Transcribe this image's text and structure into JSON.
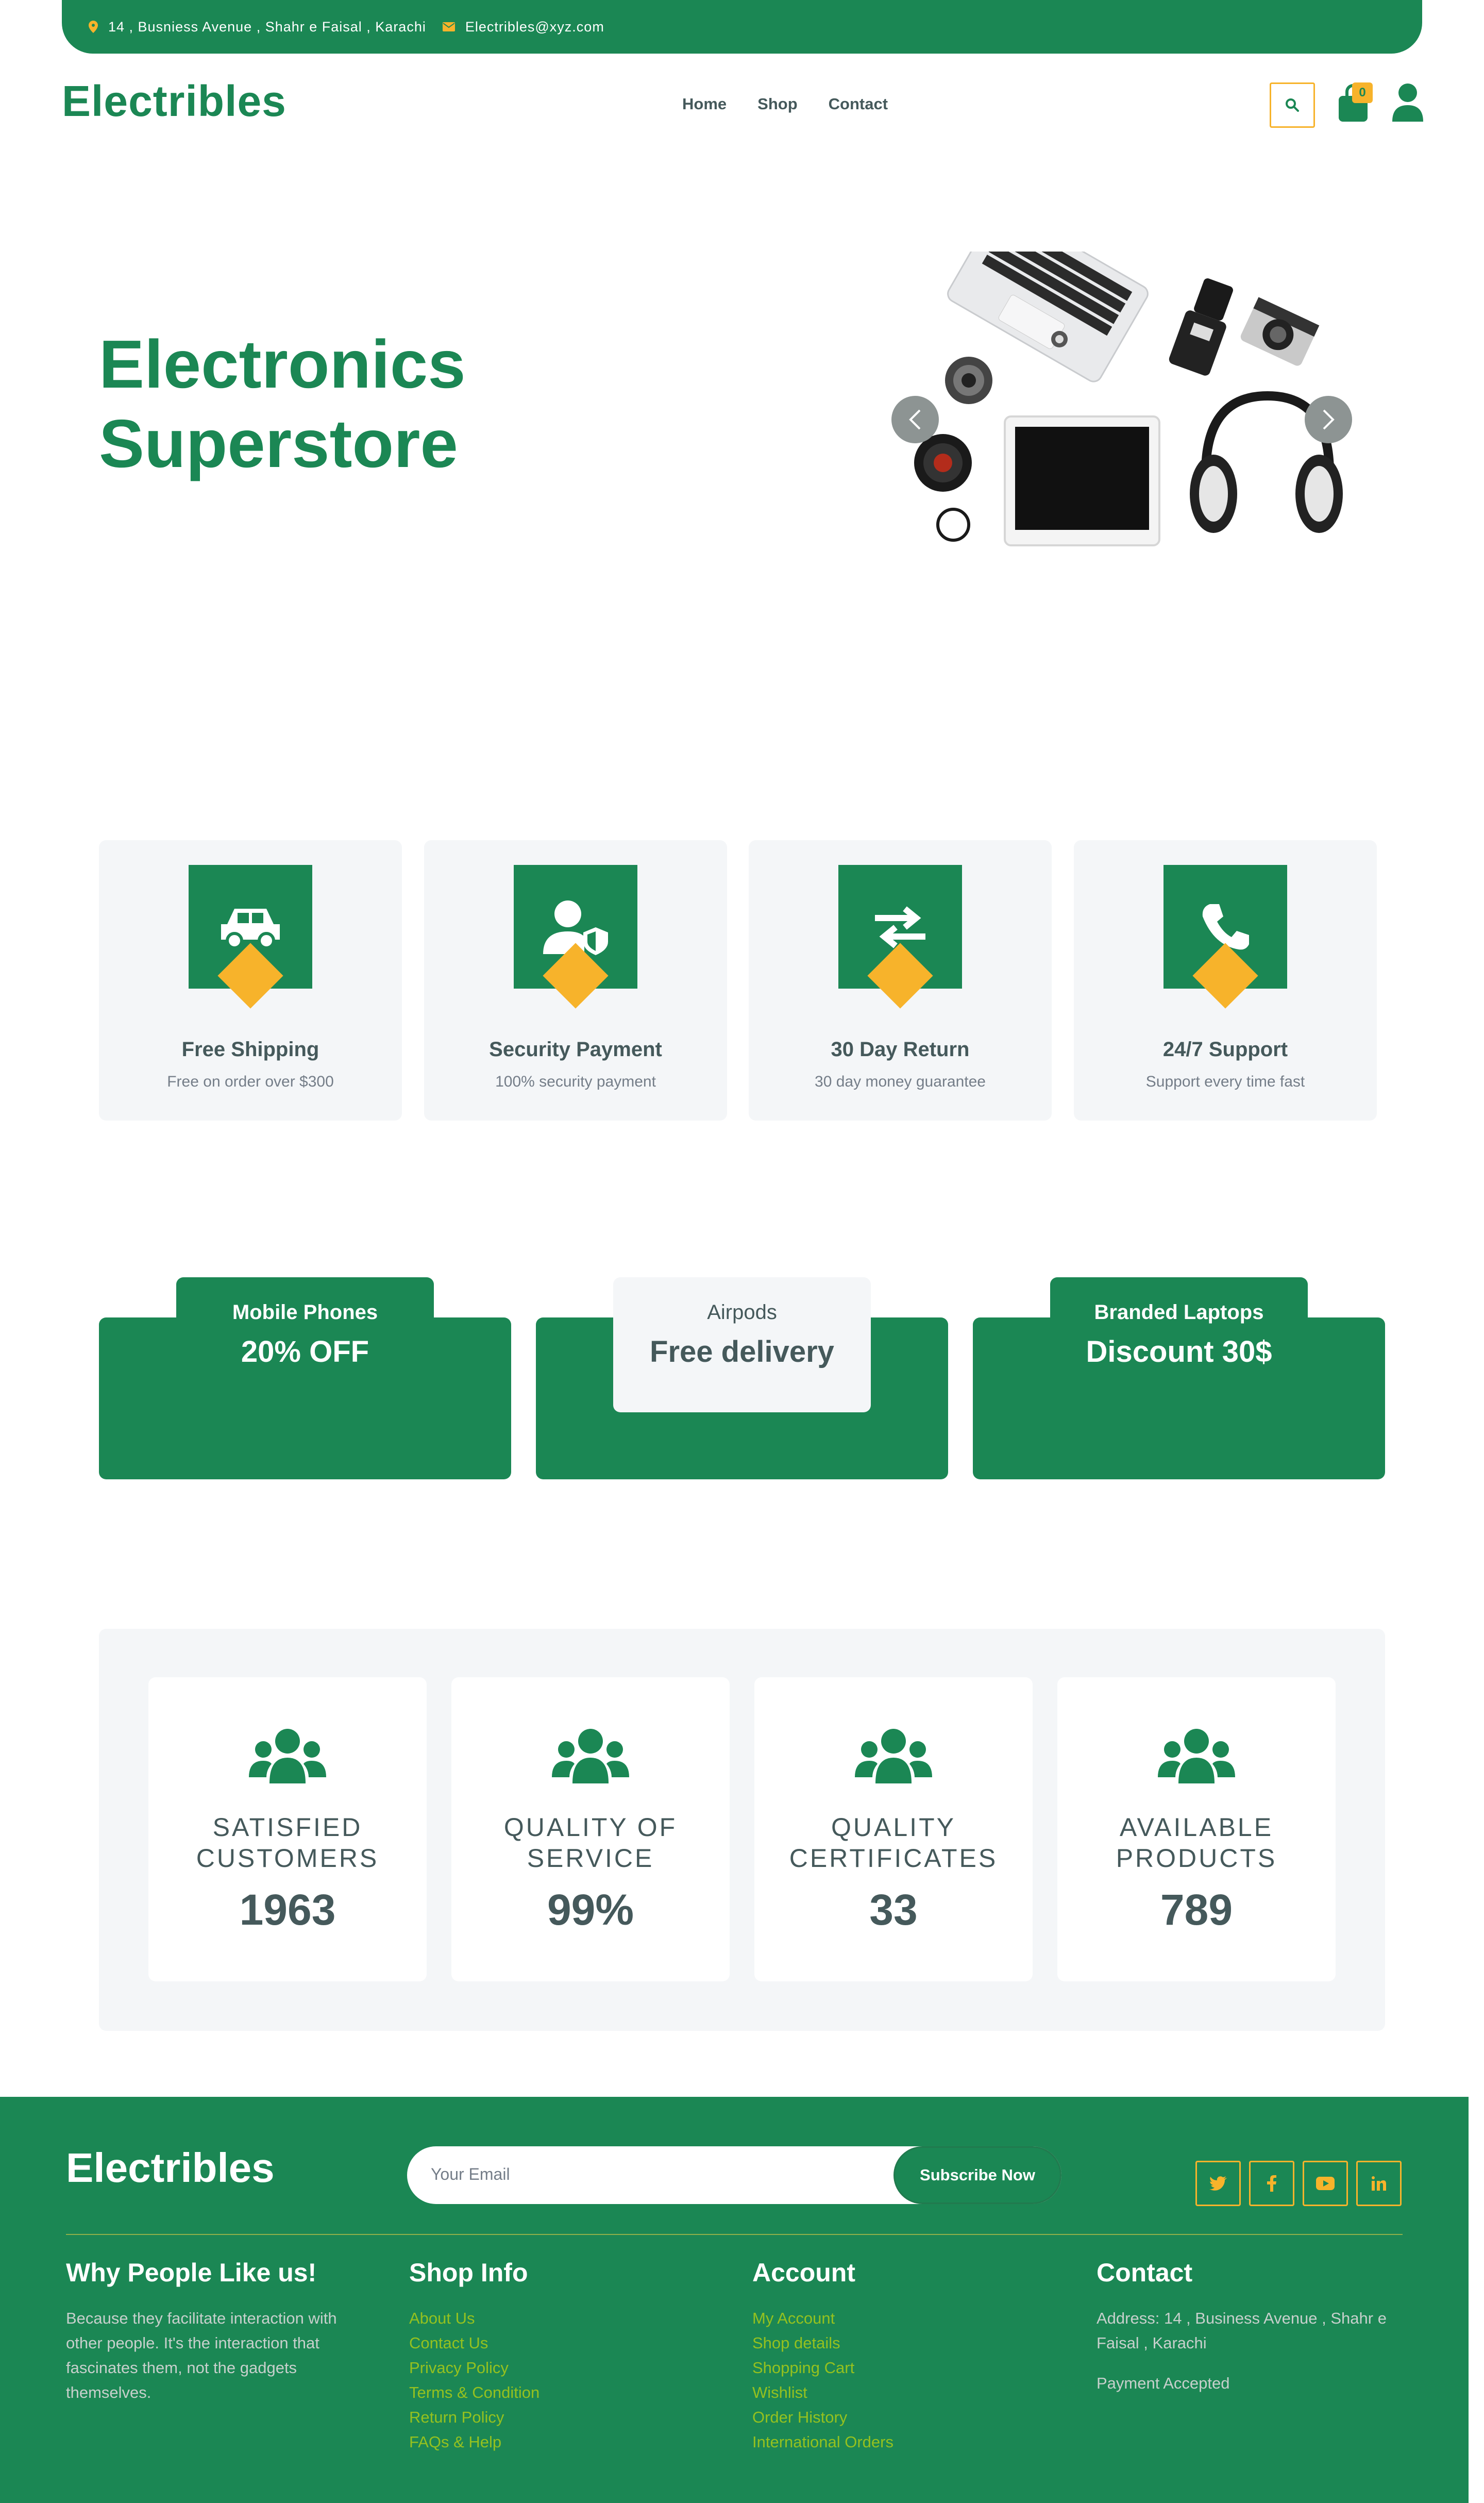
{
  "topbar": {
    "address": "14 , Busniess Avenue , Shahr e Faisal , Karachi",
    "email": "Electribles@xyz.com"
  },
  "header": {
    "logo": "Electribles",
    "nav": [
      "Home",
      "Shop",
      "Contact"
    ],
    "cart_count": "0"
  },
  "hero": {
    "title_line1": "Electronics",
    "title_line2": "Superstore"
  },
  "features": [
    {
      "title": "Free Shipping",
      "subtitle": "Free on order over $300",
      "icon": "car-icon"
    },
    {
      "title": "Security Payment",
      "subtitle": "100% security payment",
      "icon": "user-shield-icon"
    },
    {
      "title": "30 Day Return",
      "subtitle": "30 day money guarantee",
      "icon": "exchange-icon"
    },
    {
      "title": "24/7 Support",
      "subtitle": "Support every time fast",
      "icon": "phone-icon"
    }
  ],
  "promos": [
    {
      "label": "Mobile Phones",
      "offer": "20% OFF"
    },
    {
      "label": "Airpods",
      "offer": "Free delivery"
    },
    {
      "label": "Branded Laptops",
      "offer": "Discount 30$"
    }
  ],
  "stats": [
    {
      "label": "Satisfied Customers",
      "value": "1963"
    },
    {
      "label": "Quality of Service",
      "value": "99%"
    },
    {
      "label": "Quality Certificates",
      "value": "33"
    },
    {
      "label": "Available Products",
      "value": "789"
    }
  ],
  "footer": {
    "logo": "Electribles",
    "email_placeholder": "Your Email",
    "subscribe_label": "Subscribe Now",
    "why": {
      "title": "Why People Like us!",
      "text": "Because they facilitate interaction with other people. It's the interaction that fascinates them, not the gadgets themselves."
    },
    "shop_info": {
      "title": "Shop Info",
      "links": [
        "About Us",
        "Contact Us",
        "Privacy Policy",
        "Terms & Condition",
        "Return Policy",
        "FAQs & Help"
      ]
    },
    "account": {
      "title": "Account",
      "links": [
        "My Account",
        "Shop details",
        "Shopping Cart",
        "Wishlist",
        "Order History",
        "International Orders"
      ]
    },
    "contact": {
      "title": "Contact",
      "address": "Address: 14 , Business Avenue , Shahr e Faisal , Karachi",
      "payment": "Payment Accepted"
    }
  },
  "colors": {
    "primary": "#1b8754",
    "accent": "#f7b32b",
    "text": "#45595b",
    "panel": "#f4f6f8"
  }
}
